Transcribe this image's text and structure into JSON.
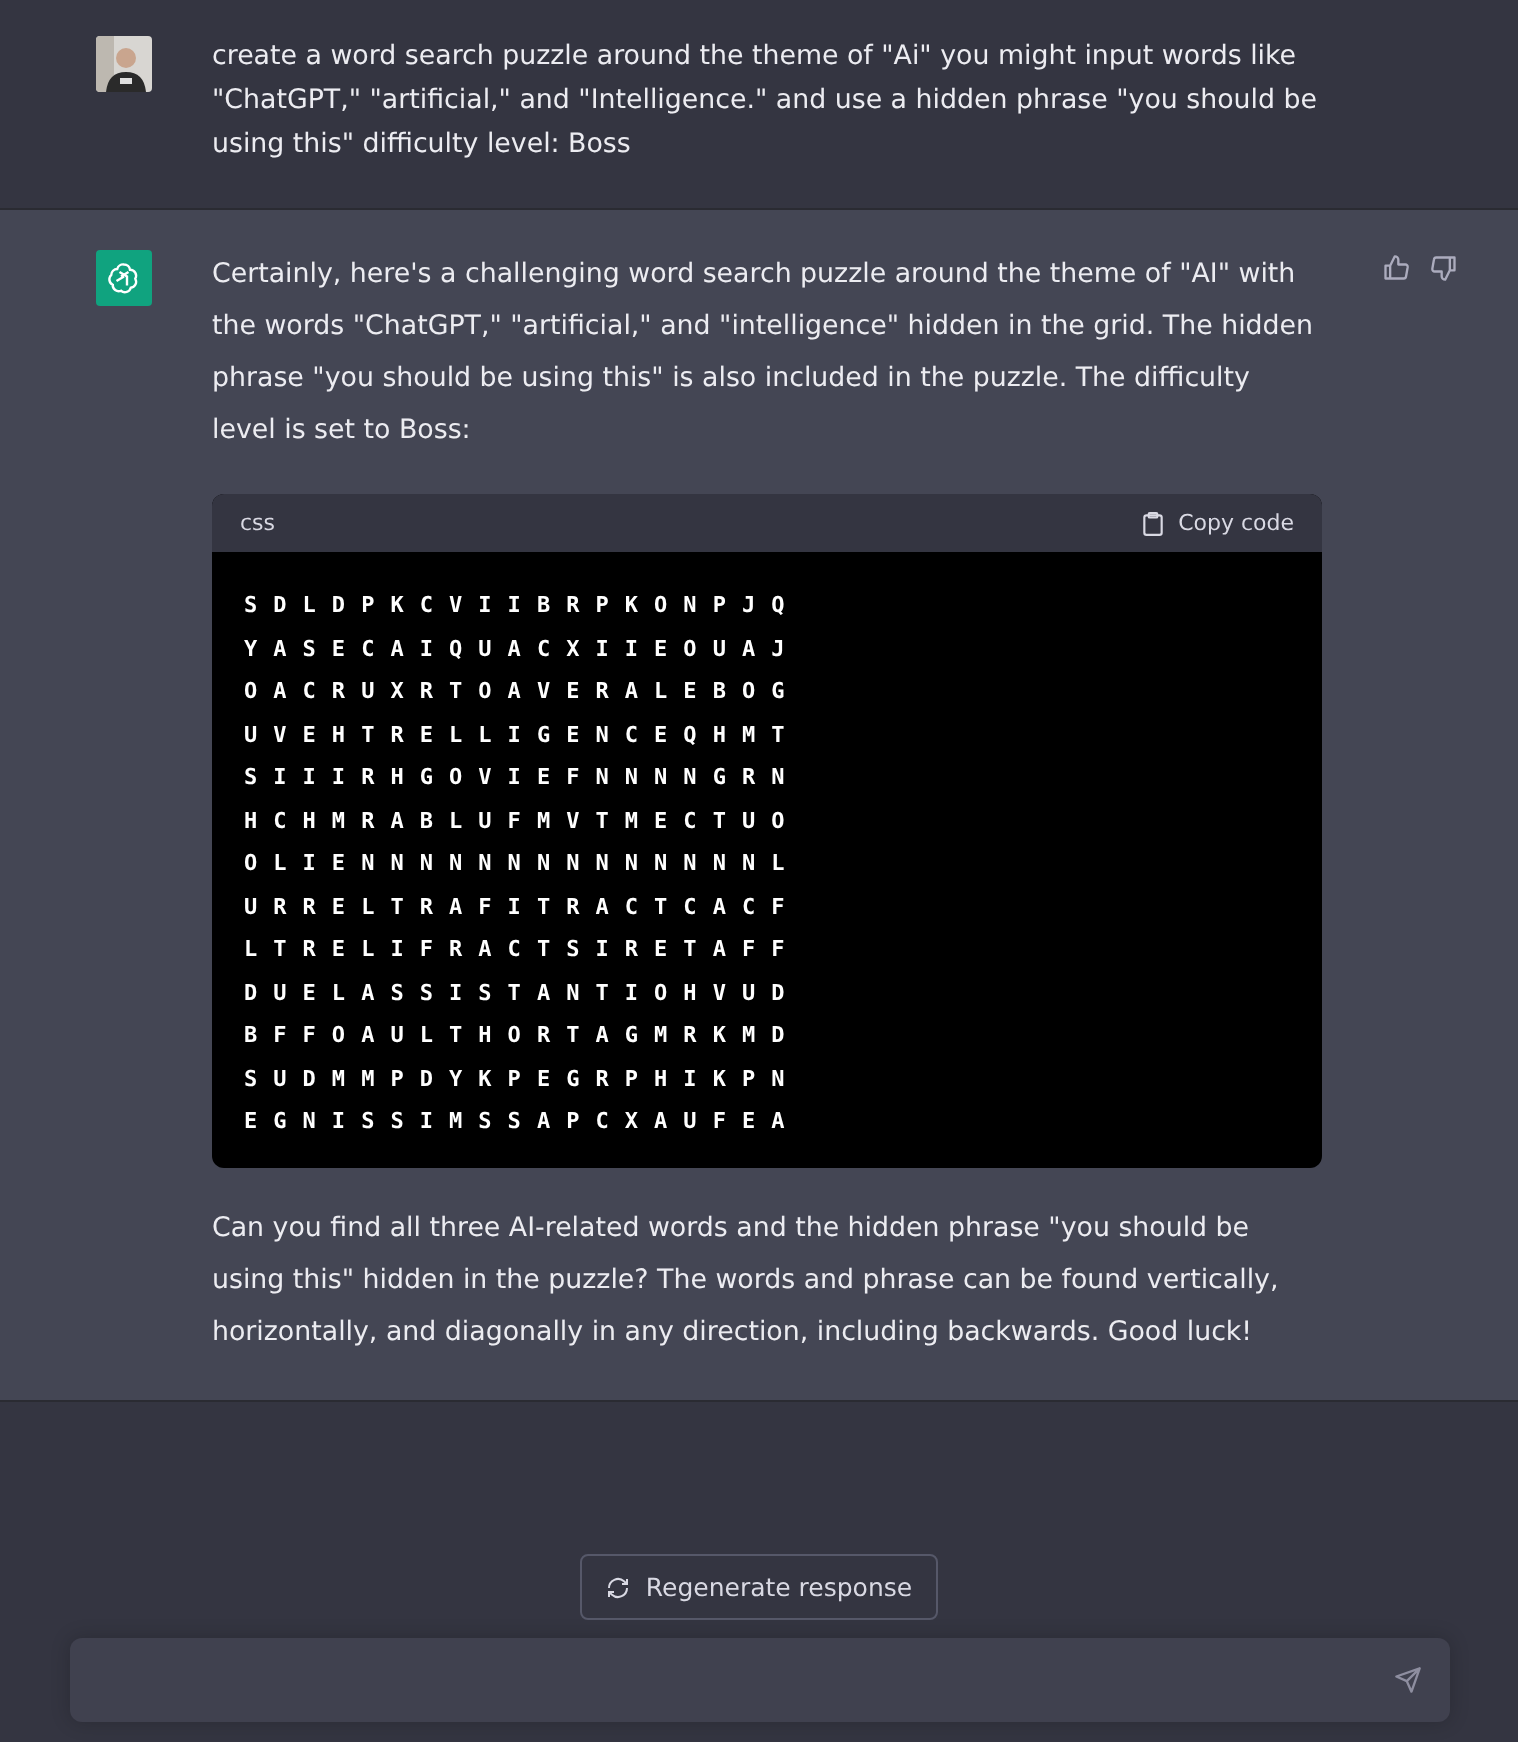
{
  "conversation": [
    {
      "kind": "user",
      "text": "create a word search puzzle around the theme of \"Ai\" you might input words like \"ChatGPT,\" \"artificial,\" and \"Intelligence.\" and use a hidden phrase \"you should be using this\" difficulty level: Boss"
    },
    {
      "kind": "assistant",
      "intro": "Certainly, here's a challenging word search puzzle around the theme of \"AI\" with the words \"ChatGPT,\" \"artificial,\" and \"intelligence\" hidden in the grid. The hidden phrase \"you should be using this\" is also included in the puzzle. The difficulty level is set to Boss:",
      "code": {
        "language": "css",
        "copy_label": "Copy code",
        "lines": [
          "S D L D P K C V I I B R P K O N P J Q",
          "Y A S E C A I Q U A C X I I E O U A J",
          "O A C R U X R T O A V E R A L E B O G",
          "U V E H T R E L L I G E N C E Q H M T",
          "S I I I R H G O V I E F N N N N G R N",
          "H C H M R A B L U F M V T M E C T U O",
          "O L I E N N N N N N N N N N N N N N L",
          "U R R E L T R A F I T R A C T C A C F",
          "L T R E L I F R A C T S I R E T A F F",
          "D U E L A S S I S T A N T I O H V U D",
          "B F F O A U L T H O R T A G M R K M D",
          "S U D M M P D Y K P E G R P H I K P N",
          "E G N I S S I M S S A P C X A U F E A"
        ]
      },
      "outro": "Can you find all three AI-related words and the hidden phrase \"you should be using this\" hidden in the puzzle? The words and phrase can be found vertically, horizontally, and diagonally in any direction, including backwards. Good luck!"
    }
  ],
  "regenerate_button": "Regenerate response"
}
